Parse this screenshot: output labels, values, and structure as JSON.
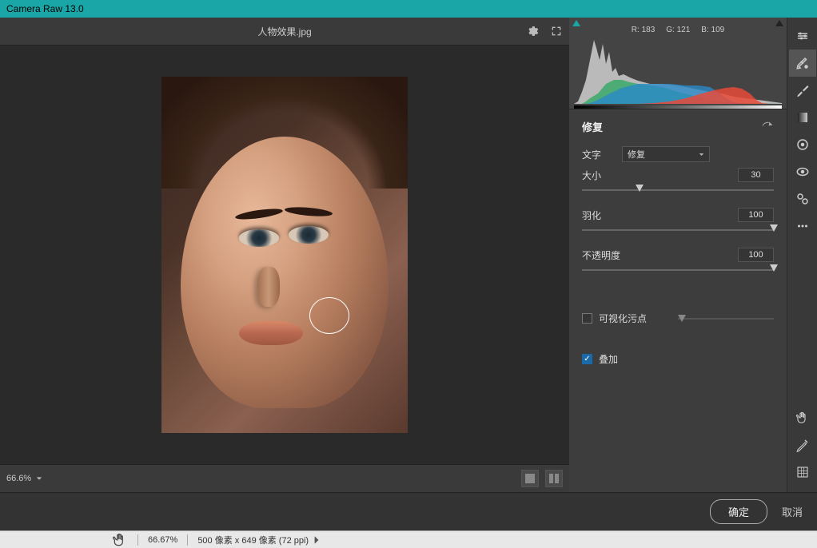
{
  "app": {
    "title": "Camera Raw 13.0"
  },
  "document": {
    "filename": "人物效果.jpg"
  },
  "histogram": {
    "r": "R: 183",
    "g": "G: 121",
    "b": "B: 109"
  },
  "panel": {
    "title": "修复",
    "type_label": "文字",
    "type_value": "修复",
    "size": {
      "label": "大小",
      "value": "30",
      "pos": 30
    },
    "feather": {
      "label": "羽化",
      "value": "100",
      "pos": 100
    },
    "opacity": {
      "label": "不透明度",
      "value": "100",
      "pos": 100
    },
    "visualize": {
      "label": "可视化污点",
      "checked": false
    },
    "overlay": {
      "label": "叠加",
      "checked": true
    }
  },
  "canvas": {
    "zoom": "66.6%"
  },
  "footer": {
    "ok": "确定",
    "cancel": "取消"
  },
  "status": {
    "zoom": "66.67%",
    "dimensions": "500 像素 x 649 像素 (72 ppi)"
  }
}
